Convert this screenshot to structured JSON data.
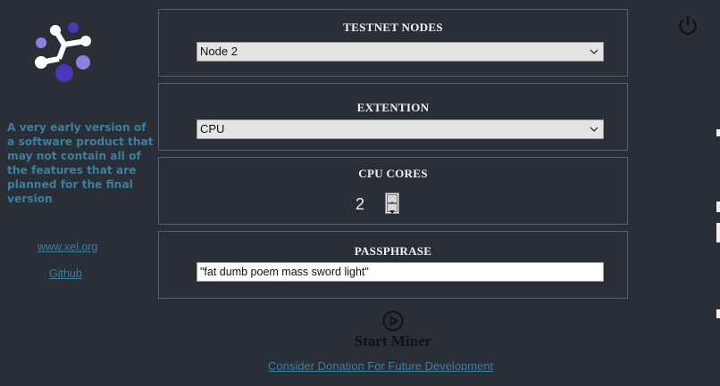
{
  "sidebar": {
    "tagline": "A very early version of a software product that may not contain all of the features that are planned for the final version",
    "website_link": "www.xel.org",
    "github_link": "Github"
  },
  "testnet_nodes": {
    "title": "TESTNET NODES",
    "selected": "Node 2"
  },
  "extension": {
    "title": "EXTENTION",
    "selected": "CPU"
  },
  "cpu_cores": {
    "title": "CPU CORES",
    "value": "2"
  },
  "passphrase": {
    "title": "PASSPHRASE",
    "value": "\"fat dumb poem mass  sword light\""
  },
  "actions": {
    "start_label": "Start Miner",
    "donate_link": "Consider Donation For Future Development"
  },
  "colors": {
    "background": "#2a2e36",
    "link": "#3d7f9c",
    "logo_purple": "#8e7fe0",
    "logo_indigo": "#4b35b8"
  },
  "icons": [
    "xel-logo-icon",
    "power-icon",
    "chevron-down-icon",
    "play-circle-icon",
    "spin-up-icon",
    "spin-down-icon"
  ]
}
